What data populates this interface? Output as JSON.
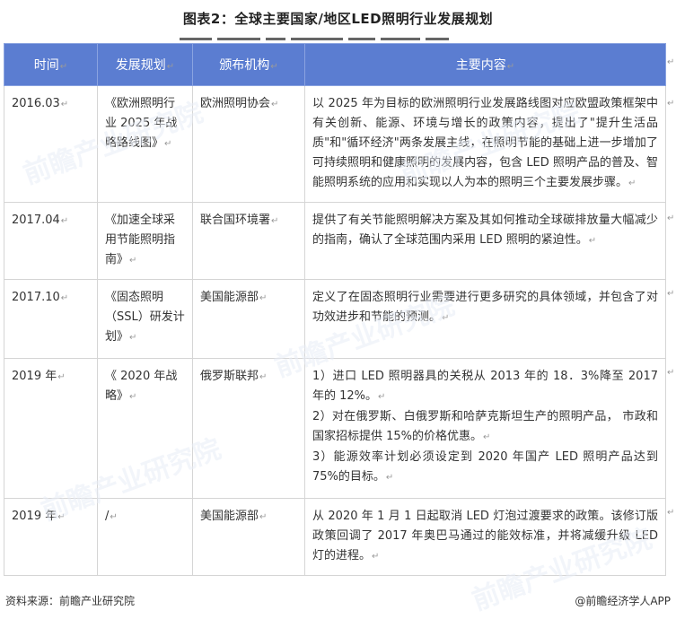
{
  "title": "图表2：全球主要国家/地区LED照明行业发展规划",
  "table": {
    "headers": [
      "时间",
      "发展规划",
      "颁布机构",
      "主要内容"
    ],
    "rows": [
      {
        "time": "2016.03",
        "plan": "《欧洲照明行业 2025 年战略路线图》",
        "agency": "欧洲照明协会",
        "content": [
          "以 2025 年为目标的欧洲照明行业发展路线图对应欧盟政策框架中有关创新、能源、环境与增长的政策内容，提出了\"提升生活品质\"和\"循环经济\"两条发展主线，在照明节能的基础上进一步增加了可持续照明和健康照明的发展内容，包含 LED 照明产品的普及、智能照明系统的应用和实现以人为本的照明三个主要发展步骤。"
        ]
      },
      {
        "time": "2017.04",
        "plan": "《加速全球采用节能照明指南》",
        "agency": "联合国环境署",
        "content": [
          "提供了有关节能照明解决方案及其如何推动全球碳排放量大幅减少的指南，确认了全球范围内采用 LED 照明的紧迫性。"
        ]
      },
      {
        "time": "2017.10",
        "plan": "《固态照明（SSL）研发计划》",
        "agency": "美国能源部",
        "content": [
          "定义了在固态照明行业需要进行更多研究的具体领域，并包含了对功效进步和节能的预测。"
        ]
      },
      {
        "time": "2019 年",
        "plan": "《 2020 年战略》",
        "agency": "俄罗斯联邦",
        "content": [
          "1）进口 LED 照明器具的关税从 2013 年的 18．3%降至 2017 年的 12%。",
          "2）对在俄罗斯、白俄罗斯和哈萨克斯坦生产的照明产品， 市政和国家招标提供 15%的价格优惠。",
          "3）能源效率计划必须设定到 2020 年国产 LED 照明产品达到 75%的目标。"
        ]
      },
      {
        "time": "2019 年",
        "plan": "/",
        "agency": "美国能源部",
        "content": [
          "从 2020 年 1 月 1 日起取消 LED 灯泡过渡要求的政策。该修订版政策回调了 2017 年奥巴马通过的能效标准，并将减缓升级 LED 灯的进程。"
        ]
      }
    ]
  },
  "footer": {
    "source": "资料来源：前瞻产业研究院",
    "brand": "@前瞻经济学人APP"
  },
  "watermark": "前瞻产业研究院",
  "colors": {
    "header_bg": "#5b7dd1",
    "header_text": "#ffffff",
    "border": "#d5d5d5"
  }
}
